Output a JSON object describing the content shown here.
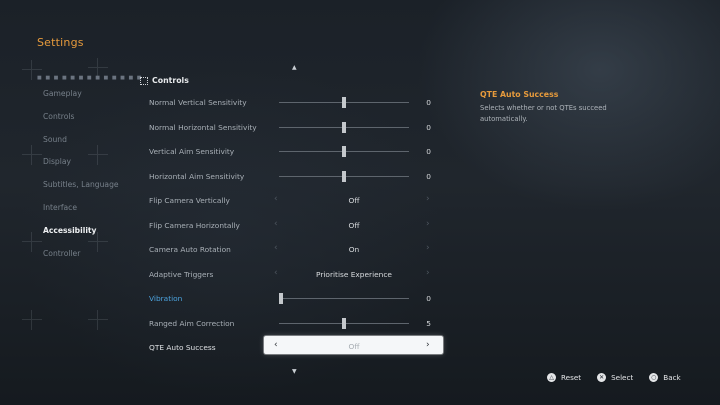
{
  "header": {
    "title": "Settings"
  },
  "sidebar": {
    "items": [
      {
        "label": "Gameplay"
      },
      {
        "label": "Controls"
      },
      {
        "label": "Sound"
      },
      {
        "label": "Display"
      },
      {
        "label": "Subtitles, Language"
      },
      {
        "label": "Interface"
      },
      {
        "label": "Accessibility"
      },
      {
        "label": "Controller"
      }
    ],
    "active_index": 6
  },
  "section": {
    "title": "Controls",
    "icon": "grid-dots-icon"
  },
  "settings": {
    "rows": [
      {
        "label": "Normal Vertical Sensitivity",
        "type": "slider",
        "value": "0",
        "fraction": 0.5
      },
      {
        "label": "Normal Horizontal Sensitivity",
        "type": "slider",
        "value": "0",
        "fraction": 0.5
      },
      {
        "label": "Vertical Aim Sensitivity",
        "type": "slider",
        "value": "0",
        "fraction": 0.5
      },
      {
        "label": "Horizontal Aim Sensitivity",
        "type": "slider",
        "value": "0",
        "fraction": 0.5
      },
      {
        "label": "Flip Camera Vertically",
        "type": "option",
        "value": "Off"
      },
      {
        "label": "Flip Camera Horizontally",
        "type": "option",
        "value": "Off"
      },
      {
        "label": "Camera Auto Rotation",
        "type": "option",
        "value": "On"
      },
      {
        "label": "Adaptive Triggers",
        "type": "option",
        "value": "Prioritise Experience"
      },
      {
        "label": "Vibration",
        "type": "slider",
        "value": "0",
        "fraction": 0.0,
        "highlight": true
      },
      {
        "label": "Ranged Aim Correction",
        "type": "slider",
        "value": "5",
        "fraction": 0.5
      },
      {
        "label": "QTE Auto Success",
        "type": "option",
        "value": "Off",
        "selected": true
      }
    ]
  },
  "description": {
    "title": "QTE Auto Success",
    "body": "Selects whether or not QTEs succeed automatically."
  },
  "footer": {
    "buttons": [
      {
        "label": "Reset",
        "icon": "triangle-button-icon",
        "glyph": "△"
      },
      {
        "label": "Select",
        "icon": "cross-button-icon",
        "glyph": "✕"
      },
      {
        "label": "Back",
        "icon": "circle-button-icon",
        "glyph": "○"
      }
    ]
  },
  "colors": {
    "accent": "#e69a3c",
    "highlight": "#4ca3de"
  }
}
